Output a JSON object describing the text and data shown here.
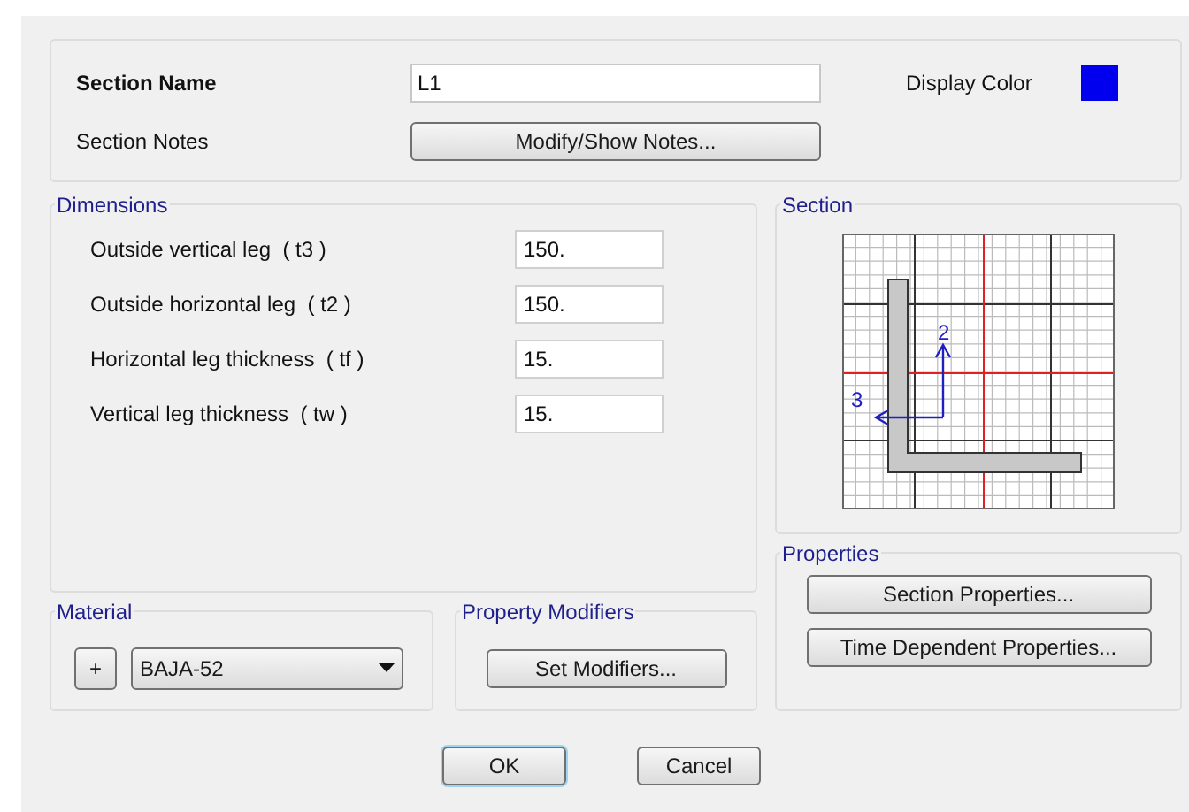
{
  "header": {
    "section_name_label": "Section Name",
    "section_name_value": "L1",
    "display_color_label": "Display Color",
    "swatch": {
      "color": "#0000ee"
    },
    "section_notes_label": "Section Notes",
    "notes_button": "Modify/Show Notes..."
  },
  "dimensions": {
    "title": "Dimensions",
    "rows": [
      {
        "label": "Outside vertical leg  ( t3 )",
        "value": "150."
      },
      {
        "label": "Outside horizontal leg  ( t2 )",
        "value": "150."
      },
      {
        "label": "Horizontal leg thickness  ( tf )",
        "value": "15."
      },
      {
        "label": "Vertical leg thickness  ( tw )",
        "value": "15."
      }
    ]
  },
  "section": {
    "title": "Section",
    "axis_vertical": "2",
    "axis_horizontal": "3"
  },
  "properties": {
    "title": "Properties",
    "buttons": [
      "Section Properties...",
      "Time Dependent Properties..."
    ]
  },
  "material": {
    "title": "Material",
    "add_button": "+",
    "value": "BAJA-52"
  },
  "property_modifiers": {
    "title": "Property Modifiers",
    "button": "Set Modifiers..."
  },
  "buttons": [
    "OK",
    "Cancel"
  ]
}
